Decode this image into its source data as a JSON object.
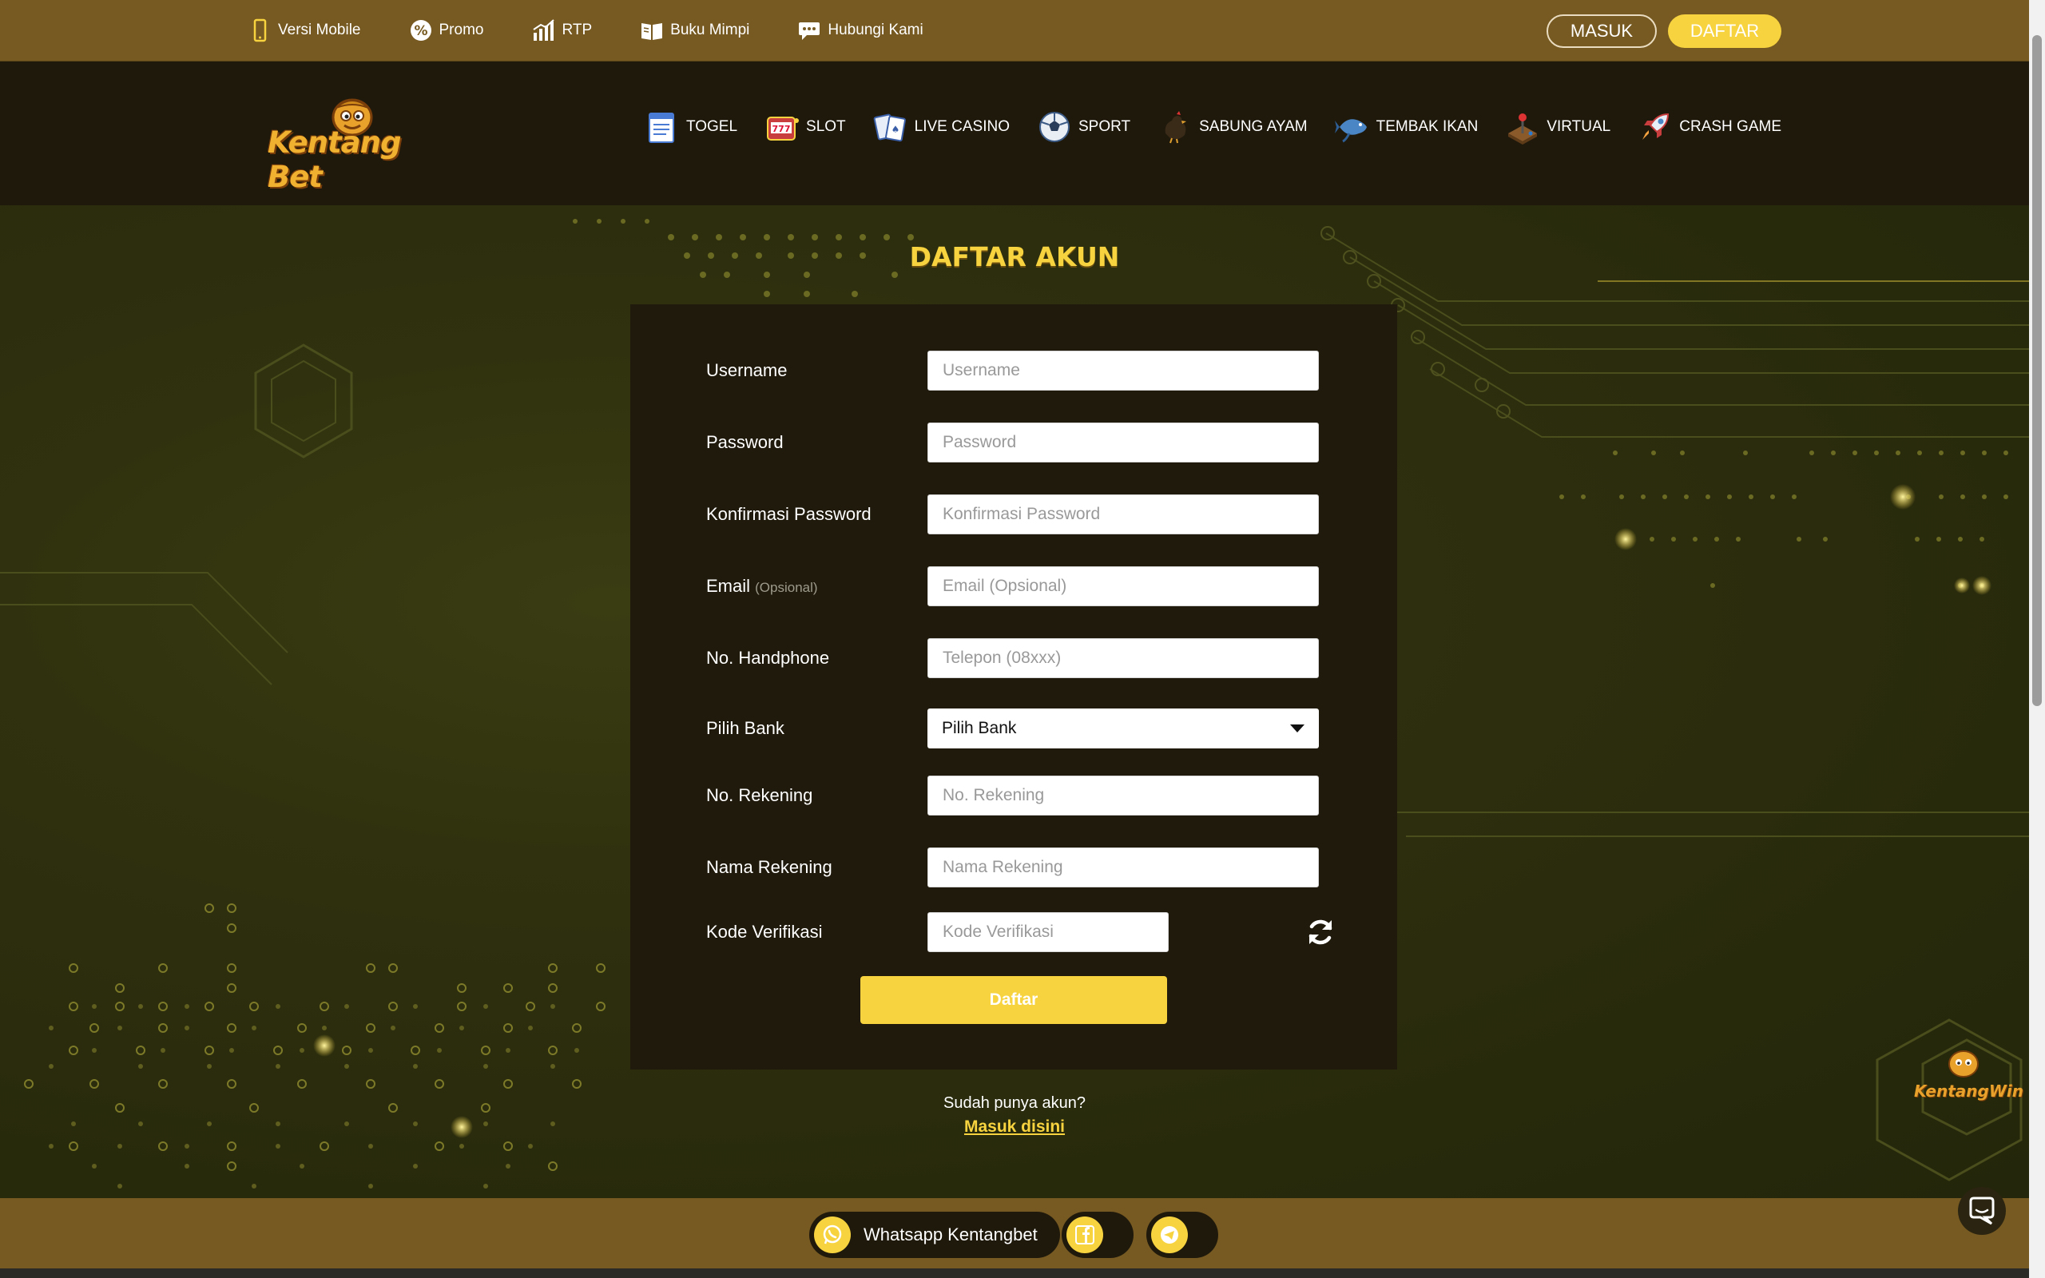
{
  "topbar": {
    "links": [
      {
        "label": "Versi Mobile",
        "icon": "mobile-icon"
      },
      {
        "label": "Promo",
        "icon": "promo-icon"
      },
      {
        "label": "RTP",
        "icon": "chart-icon"
      },
      {
        "label": "Buku Mimpi",
        "icon": "book-icon"
      },
      {
        "label": "Hubungi Kami",
        "icon": "chat-icon"
      }
    ],
    "login_label": "MASUK",
    "register_label": "DAFTAR"
  },
  "header": {
    "logo_text": "Kentang Bet",
    "nav": [
      {
        "label": "TOGEL",
        "icon": "notepad-icon"
      },
      {
        "label": "SLOT",
        "icon": "slot-machine-icon"
      },
      {
        "label": "LIVE CASINO",
        "icon": "cards-icon"
      },
      {
        "label": "SPORT",
        "icon": "soccer-ball-icon"
      },
      {
        "label": "SABUNG AYAM",
        "icon": "rooster-icon"
      },
      {
        "label": "TEMBAK IKAN",
        "icon": "fish-icon"
      },
      {
        "label": "VIRTUAL",
        "icon": "joystick-icon"
      },
      {
        "label": "CRASH GAME",
        "icon": "rocket-icon"
      }
    ]
  },
  "form": {
    "title": "DAFTAR AKUN",
    "fields": {
      "username": {
        "label": "Username",
        "placeholder": "Username"
      },
      "password": {
        "label": "Password",
        "placeholder": "Password"
      },
      "confirm": {
        "label": "Konfirmasi Password",
        "placeholder": "Konfirmasi Password"
      },
      "email": {
        "label": "Email",
        "optional": "(Opsional)",
        "placeholder": "Email (Opsional)"
      },
      "phone": {
        "label": "No. Handphone",
        "placeholder": "Telepon (08xxx)"
      },
      "bank": {
        "label": "Pilih Bank",
        "value": "Pilih Bank"
      },
      "account_no": {
        "label": "No. Rekening",
        "placeholder": "No. Rekening"
      },
      "account_name": {
        "label": "Nama Rekening",
        "placeholder": "Nama Rekening"
      },
      "captcha": {
        "label": "Kode Verifikasi",
        "placeholder": "Kode Verifikasi"
      }
    },
    "submit_label": "Daftar",
    "have_account": "Sudah punya akun?",
    "login_link": "Masuk disini"
  },
  "bottombar": {
    "whatsapp_label": "Whatsapp Kentangbet"
  },
  "badge_text": "KentangWin",
  "colors": {
    "accent": "#f7d33f",
    "topbar": "#775a21",
    "panel": "#201a0c"
  }
}
